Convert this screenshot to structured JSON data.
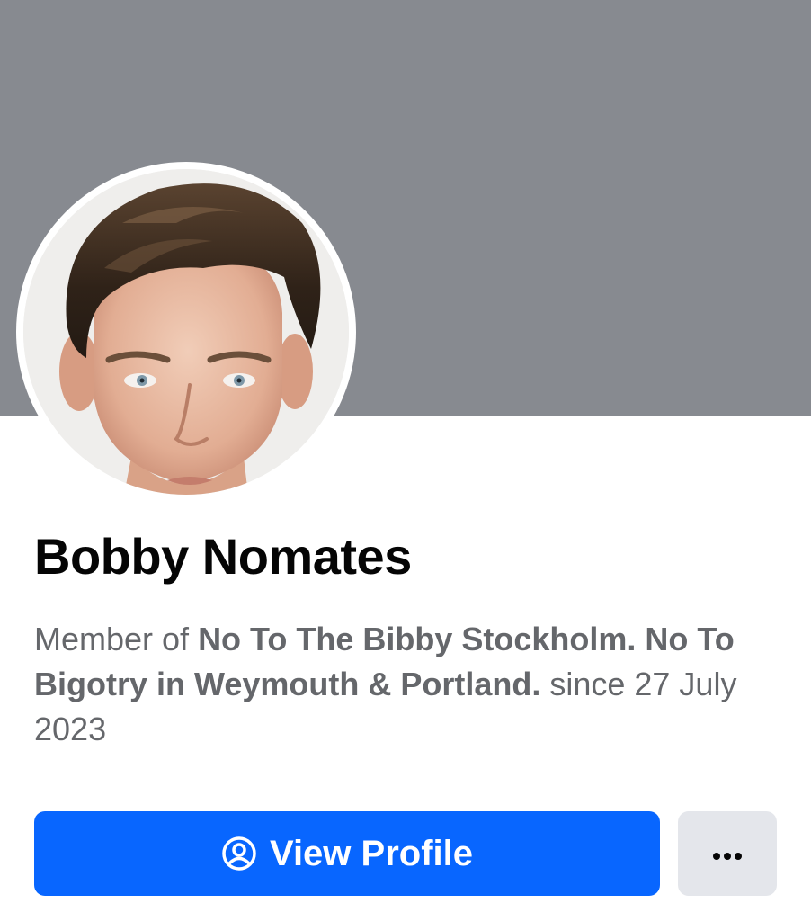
{
  "profile": {
    "name": "Bobby Nomates",
    "membership_prefix": "Member of ",
    "group_name": "No To The Bibby Stockholm. No To Bigotry in Weymouth & Portland.",
    "membership_suffix": " since 27 July 2023"
  },
  "actions": {
    "view_profile_label": "View Profile",
    "view_profile_icon": "user-circle-icon",
    "more_icon": "more-dots-icon"
  },
  "colors": {
    "cover": "#878a90",
    "primary_button": "#0866ff",
    "secondary_button": "#e4e6eb",
    "name_text": "#050505",
    "secondary_text": "#65676b"
  }
}
